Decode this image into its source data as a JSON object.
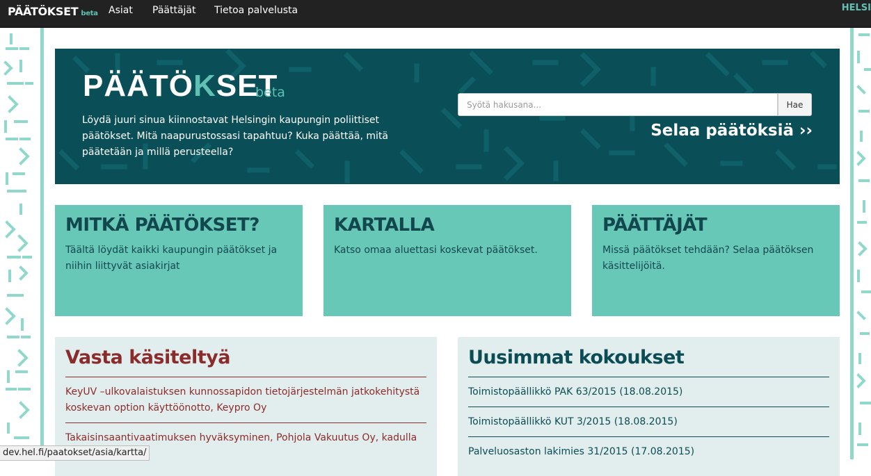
{
  "navbar": {
    "brand": "PÄÄTÖKSET",
    "brand_beta": "beta",
    "links": [
      "Asiat",
      "Päättäjät",
      "Tietoa palvelusta"
    ],
    "right_text": "HELSI"
  },
  "hero": {
    "logo_left": "PÄÄTÖ",
    "logo_mark": "K",
    "logo_right": "SET",
    "logo_beta": "beta",
    "description": "Löydä juuri sinua kiinnostavat Helsingin kaupungin poliittiset päätökset. Mitä naapurustossasi tapahtuu? Kuka päättää, mitä päätetään ja millä perusteella?",
    "search_placeholder": "Syötä hakusana...",
    "search_button": "Hae",
    "browse_link": "Selaa päätöksiä ››"
  },
  "boxes": [
    {
      "title": "MITKÄ PÄÄTÖKSET?",
      "text": "Täältä löydät kaikki kaupungin päätökset ja niihin liittyvät asiakirjat"
    },
    {
      "title": "KARTALLA",
      "text": "Katso omaa aluettasi koskevat päätökset."
    },
    {
      "title": "PÄÄTTÄJÄT",
      "text": "Missä päätökset tehdään? Selaa päätöksen käsittelijöitä."
    }
  ],
  "recent": {
    "title": "Vasta käsiteltyä",
    "items": [
      "KeyUV –ulkovalaistuksen kunnossapidon tietojärjestelmän jatkokehitystä koskevan option käyttöönotto, Keypro Oy",
      "Takaisinsaantivaatimuksen hyväksyminen, Pohjola Vakuutus Oy, kadulla Kluuvissa"
    ]
  },
  "meetings": {
    "title": "Uusimmat kokoukset",
    "items": [
      "Toimistopäällikkö PAK 63/2015 (18.08.2015)",
      "Toimistopäällikkö KUT 3/2015 (18.08.2015)",
      "Palveluosaston lakimies 31/2015 (17.08.2015)"
    ]
  },
  "statusbar": {
    "url": "dev.hel.fi/paatokset/asia/kartta/"
  },
  "colors": {
    "navbar": "#222222",
    "hero": "#0a4f58",
    "accent": "#5fc1b4",
    "box": "#67c8b8",
    "panel": "#e1eeed",
    "recent_title": "#8c2b2b",
    "meetings_title": "#0c4c55"
  }
}
